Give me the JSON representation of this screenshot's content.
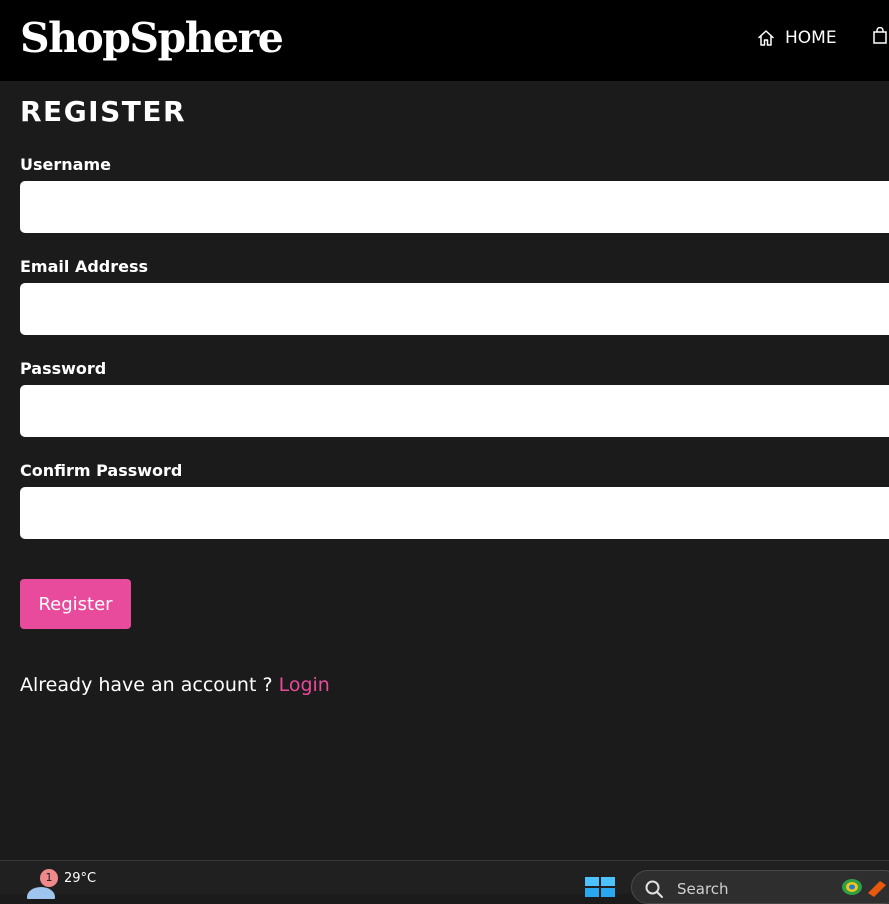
{
  "navbar": {
    "brand": "ShopSphere",
    "home_label": "HOME",
    "home_icon": "home-icon",
    "cart_icon": "shopping-bag-icon"
  },
  "page": {
    "title": "REGISTER"
  },
  "form": {
    "fields": [
      {
        "label": "Username",
        "value": "",
        "placeholder": ""
      },
      {
        "label": "Email Address",
        "value": "",
        "placeholder": ""
      },
      {
        "label": "Password",
        "value": "",
        "placeholder": ""
      },
      {
        "label": "Confirm Password",
        "value": "",
        "placeholder": ""
      }
    ],
    "submit_label": "Register"
  },
  "login_prompt": {
    "text": "Already have an account ? ",
    "link_label": "Login"
  },
  "taskbar": {
    "weather_badge": "1",
    "weather_temp": "29°C",
    "search_label": "Search",
    "start_icon": "windows-start-icon"
  },
  "colors": {
    "accent": "#e84a9c",
    "navbar_bg": "#000000",
    "page_bg": "#1b1b1b"
  }
}
